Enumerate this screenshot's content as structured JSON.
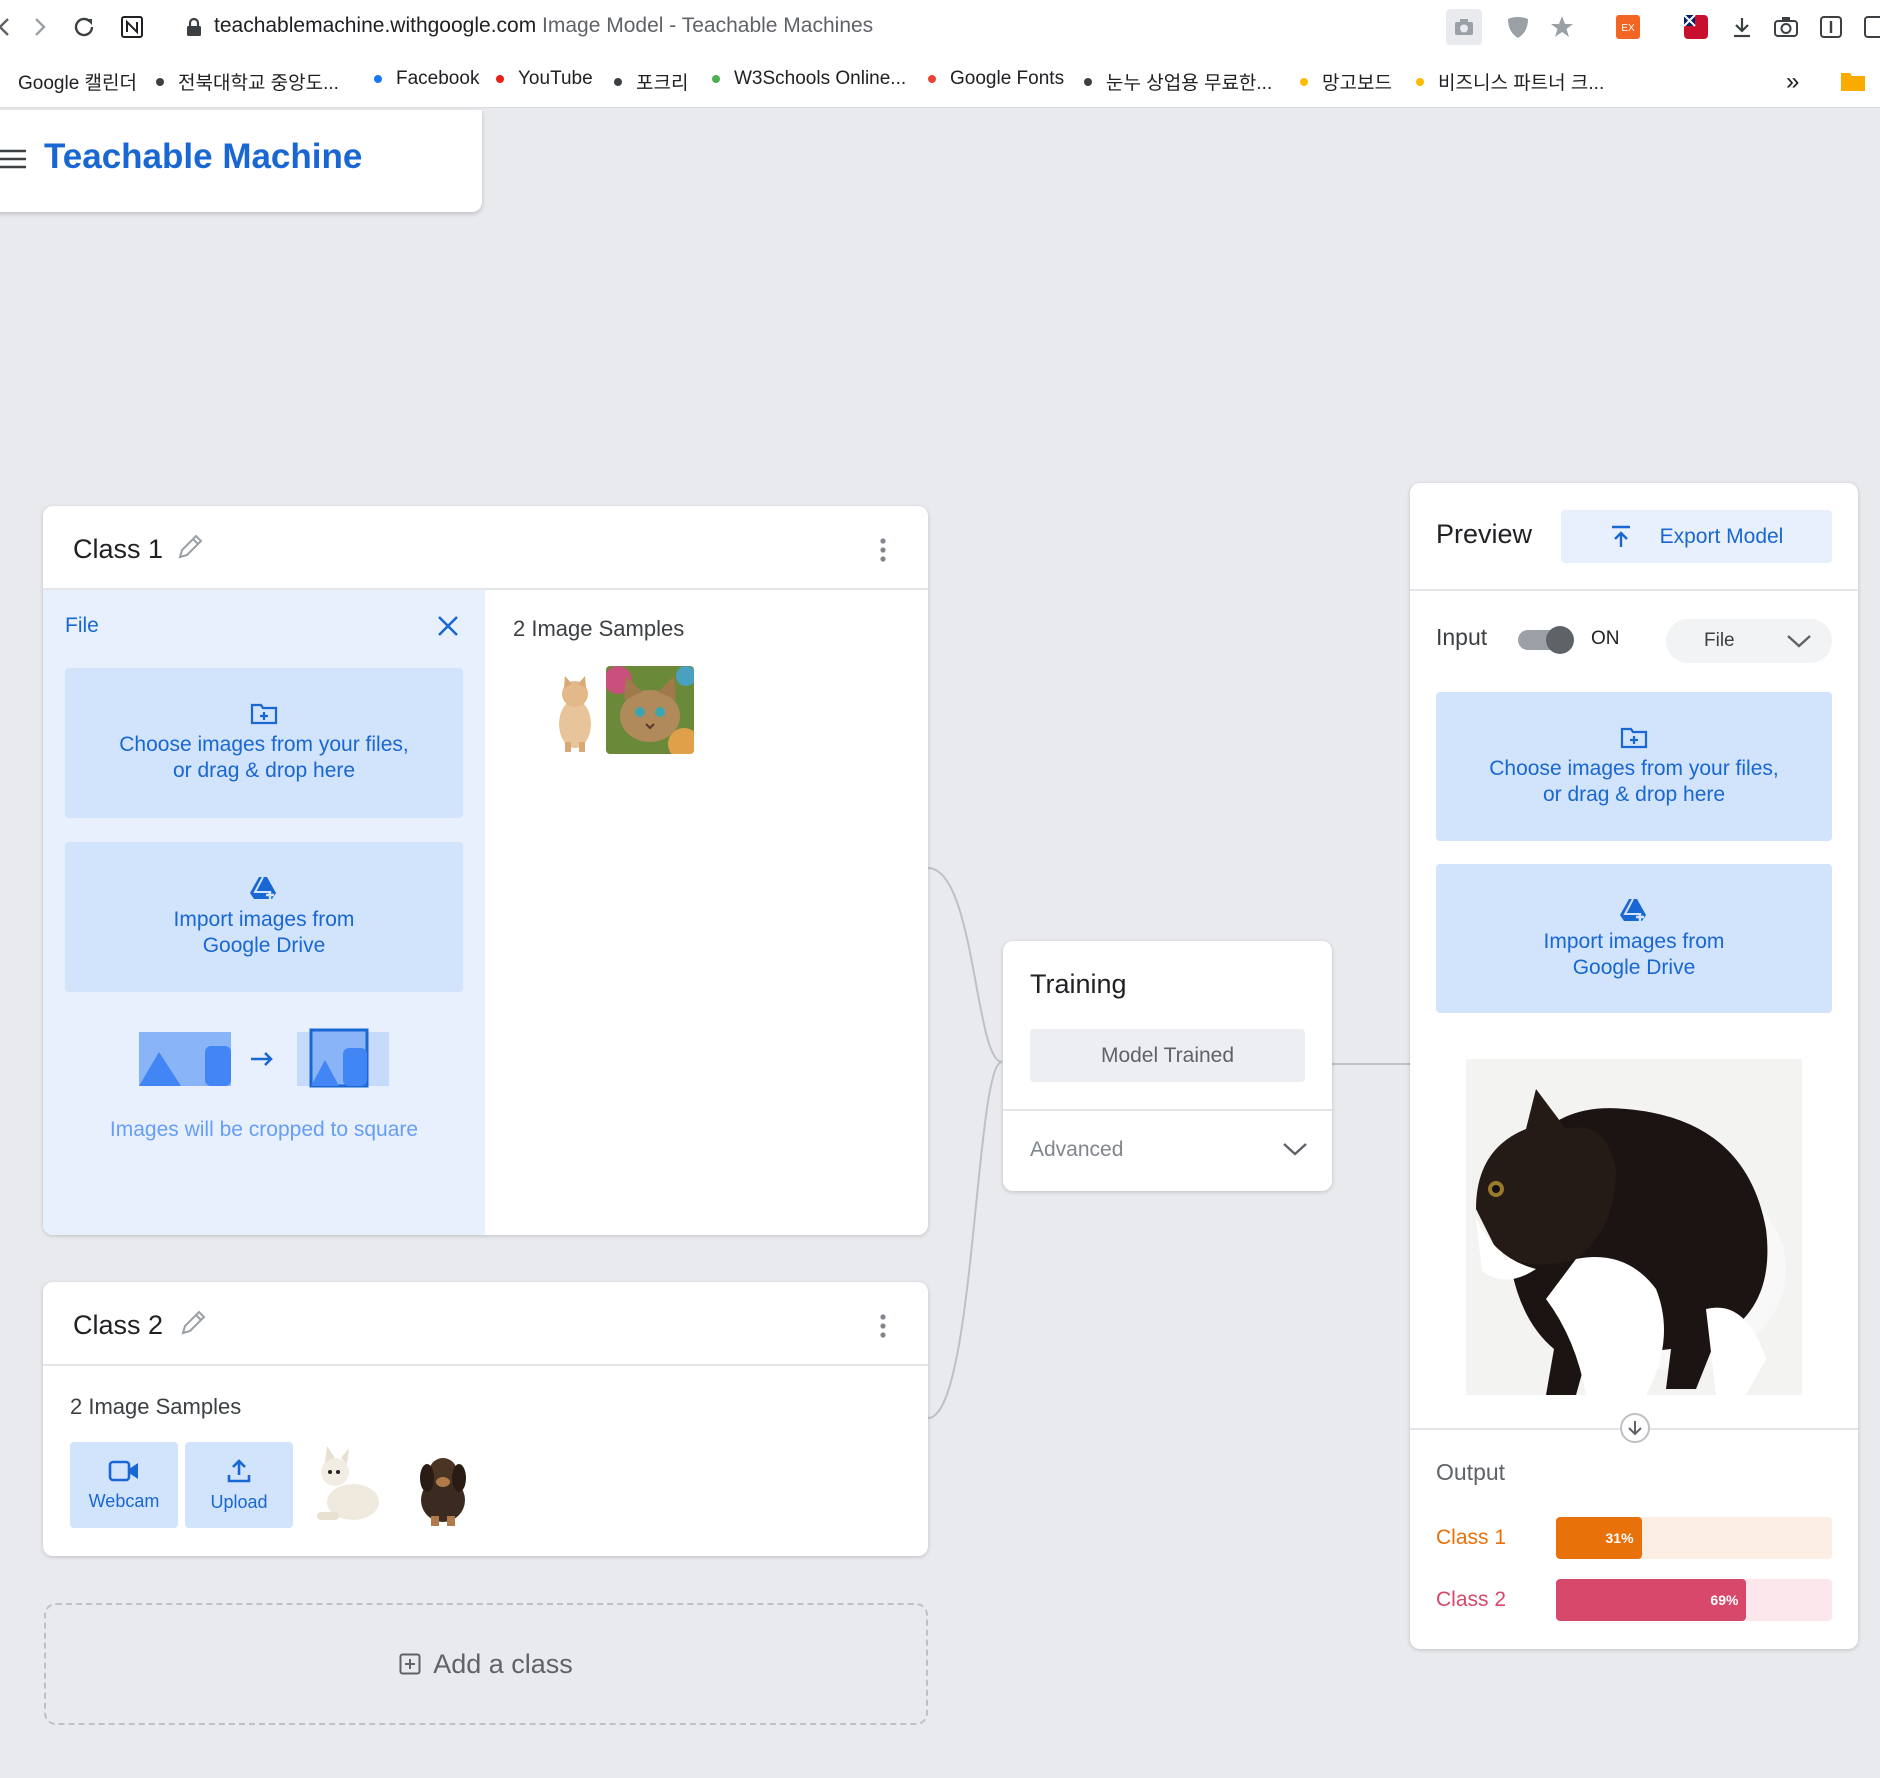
{
  "browser": {
    "url_host": "teachablemachine.withgoogle.com",
    "page_title": "Image Model - Teachable Machines",
    "bookmarks": [
      {
        "label": "Google 캘린더",
        "dot": "#4285f4"
      },
      {
        "label": "전북대학교 중앙도...",
        "dot": "#3c4043"
      },
      {
        "label": "Facebook",
        "dot": "#1877f2"
      },
      {
        "label": "YouTube",
        "dot": "#e62117"
      },
      {
        "label": "포크리",
        "dot": "#3c4043"
      },
      {
        "label": "W3Schools Online...",
        "dot": "#4caf50"
      },
      {
        "label": "Google Fonts",
        "dot": "#ea4335"
      },
      {
        "label": "눈누 상업용 무료한...",
        "dot": "#3c4043"
      },
      {
        "label": "망고보드",
        "dot": "#fbbc04"
      },
      {
        "label": "비즈니스 파트너 크...",
        "dot": "#fbbc04"
      }
    ],
    "more_bookmarks": "»"
  },
  "app": {
    "title": "Teachable Machine"
  },
  "class1": {
    "name": "Class 1",
    "panel_title": "File",
    "upload_files_line1": "Choose images from your files,",
    "upload_files_line2": "or drag & drop here",
    "drive_line1": "Import images from",
    "drive_line2": "Google Drive",
    "crop_note": "Images will be cropped to square",
    "samples_label": "2 Image Samples"
  },
  "class2": {
    "name": "Class 2",
    "samples_label": "2 Image Samples",
    "webcam_label": "Webcam",
    "upload_label": "Upload"
  },
  "add_class": {
    "label": "Add a class"
  },
  "training": {
    "title": "Training",
    "status_button": "Model Trained",
    "advanced_label": "Advanced"
  },
  "preview": {
    "title": "Preview",
    "export_label": "Export Model",
    "input_label": "Input",
    "toggle_state": "ON",
    "source_select": "File",
    "upload_files_line1": "Choose images from your files,",
    "upload_files_line2": "or drag & drop here",
    "drive_line1": "Import images from",
    "drive_line2": "Google Drive",
    "output_title": "Output",
    "outputs": [
      {
        "label": "Class 1",
        "percent": "31%",
        "value": 0.31,
        "color": "#e8710a",
        "track": "#fdeee3"
      },
      {
        "label": "Class 2",
        "percent": "69%",
        "value": 0.69,
        "color": "#d7486a",
        "track": "#fce8ec"
      }
    ]
  }
}
